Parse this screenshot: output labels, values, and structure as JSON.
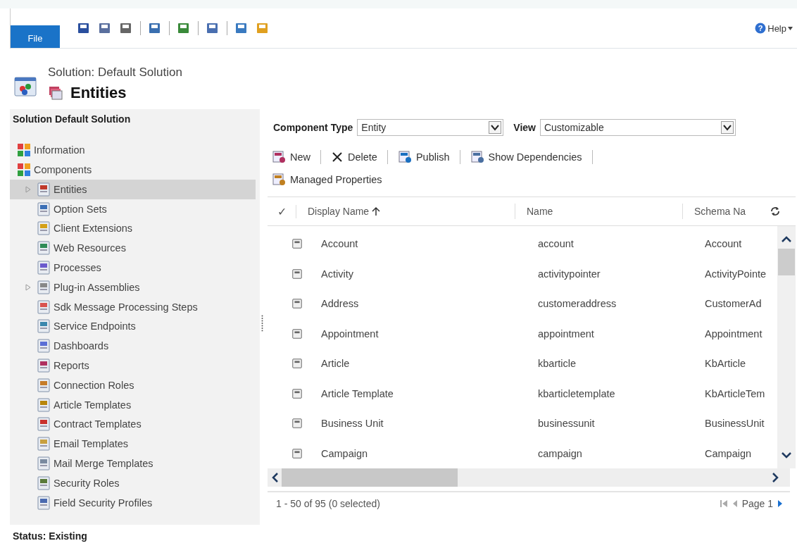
{
  "ribbon": {
    "file_tab": "File",
    "help": "Help",
    "help_glyph": "?"
  },
  "header": {
    "breadcrumb": "Solution: Default Solution",
    "title": "Entities"
  },
  "sidebar": {
    "heading": "Solution Default Solution",
    "items": [
      {
        "label": "Information",
        "selected": false,
        "expandable": false
      },
      {
        "label": "Components",
        "selected": false,
        "expandable": false,
        "children": [
          {
            "label": "Entities",
            "selected": true,
            "expandable": true
          },
          {
            "label": "Option Sets",
            "selected": false,
            "expandable": false
          },
          {
            "label": "Client Extensions",
            "selected": false,
            "expandable": false
          },
          {
            "label": "Web Resources",
            "selected": false,
            "expandable": false
          },
          {
            "label": "Processes",
            "selected": false,
            "expandable": false
          },
          {
            "label": "Plug-in Assemblies",
            "selected": false,
            "expandable": true
          },
          {
            "label": "Sdk Message Processing Steps",
            "selected": false,
            "expandable": false
          },
          {
            "label": "Service Endpoints",
            "selected": false,
            "expandable": false
          },
          {
            "label": "Dashboards",
            "selected": false,
            "expandable": false
          },
          {
            "label": "Reports",
            "selected": false,
            "expandable": false
          },
          {
            "label": "Connection Roles",
            "selected": false,
            "expandable": false
          },
          {
            "label": "Article Templates",
            "selected": false,
            "expandable": false
          },
          {
            "label": "Contract Templates",
            "selected": false,
            "expandable": false
          },
          {
            "label": "Email Templates",
            "selected": false,
            "expandable": false
          },
          {
            "label": "Mail Merge Templates",
            "selected": false,
            "expandable": false
          },
          {
            "label": "Security Roles",
            "selected": false,
            "expandable": false
          },
          {
            "label": "Field Security Profiles",
            "selected": false,
            "expandable": false
          }
        ]
      }
    ]
  },
  "status": "Status: Existing",
  "filters": [
    {
      "label": "Component Type",
      "value": "Entity"
    },
    {
      "label": "View",
      "value": "Customizable"
    }
  ],
  "toolbar": [
    {
      "label": "New",
      "kind": "new"
    },
    {
      "label": "Delete",
      "kind": "delete"
    },
    {
      "label": "Publish",
      "kind": "publish"
    },
    {
      "label": "Show Dependencies",
      "kind": "dependencies"
    },
    {
      "label": "Managed Properties",
      "kind": "properties"
    }
  ],
  "table": {
    "check_header": "✓",
    "columns": [
      {
        "label": "Display Name",
        "sorted": true
      },
      {
        "label": "Name",
        "sorted": false
      },
      {
        "label": "Schema Na",
        "sorted": false
      }
    ],
    "rows": [
      {
        "display_name": "Account",
        "name": "account",
        "schema_name": "Account"
      },
      {
        "display_name": "Activity",
        "name": "activitypointer",
        "schema_name": "ActivityPointe"
      },
      {
        "display_name": "Address",
        "name": "customeraddress",
        "schema_name": "CustomerAd"
      },
      {
        "display_name": "Appointment",
        "name": "appointment",
        "schema_name": "Appointment"
      },
      {
        "display_name": "Article",
        "name": "kbarticle",
        "schema_name": "KbArticle"
      },
      {
        "display_name": "Article Template",
        "name": "kbarticletemplate",
        "schema_name": "KbArticleTem"
      },
      {
        "display_name": "Business Unit",
        "name": "businessunit",
        "schema_name": "BusinessUnit"
      },
      {
        "display_name": "Campaign",
        "name": "campaign",
        "schema_name": "Campaign"
      }
    ]
  },
  "footer": {
    "summary": "1 - 50 of 95 (0 selected)",
    "page": "Page 1"
  }
}
